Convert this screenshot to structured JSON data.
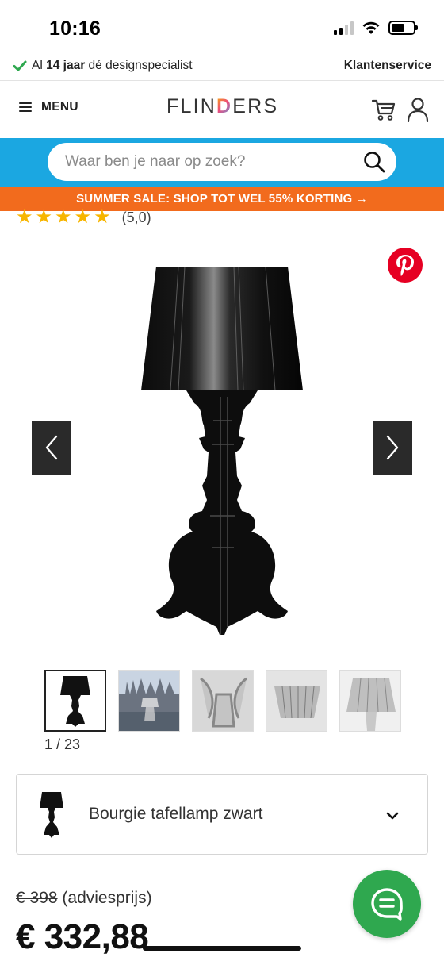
{
  "status_bar": {
    "time": "10:16"
  },
  "usp_bar": {
    "prefix": "Al ",
    "bold": "14 jaar",
    "suffix": " dé designspecialist",
    "customer_service": "Klantenservice"
  },
  "header": {
    "menu_label": "MENU",
    "logo_text_1": "FLIN",
    "logo_text_d": "D",
    "logo_text_2": "ERS"
  },
  "search": {
    "placeholder": "Waar ben je naar op zoek?"
  },
  "sale_banner": {
    "text": "SUMMER SALE: SHOP TOT WEL 55% KORTING →"
  },
  "rating": {
    "stars": 5,
    "text": "(5,0)"
  },
  "gallery": {
    "counter": "1 / 23",
    "thumbnails": [
      "black-lamp",
      "lamp-in-city",
      "clear-lamp-base",
      "clear-lamp-shade",
      "clear-lamp-full"
    ]
  },
  "variant": {
    "label": "Bourgie tafellamp zwart"
  },
  "price": {
    "old": "€ 398",
    "old_suffix": " (adviesprijs)",
    "current": "€ 332,88"
  },
  "colors": {
    "accent_blue": "#1ba7e1",
    "sale_orange": "#f26b1d",
    "star_yellow": "#f7b500",
    "chat_green": "#2fa84f",
    "pinterest_red": "#e60023"
  }
}
